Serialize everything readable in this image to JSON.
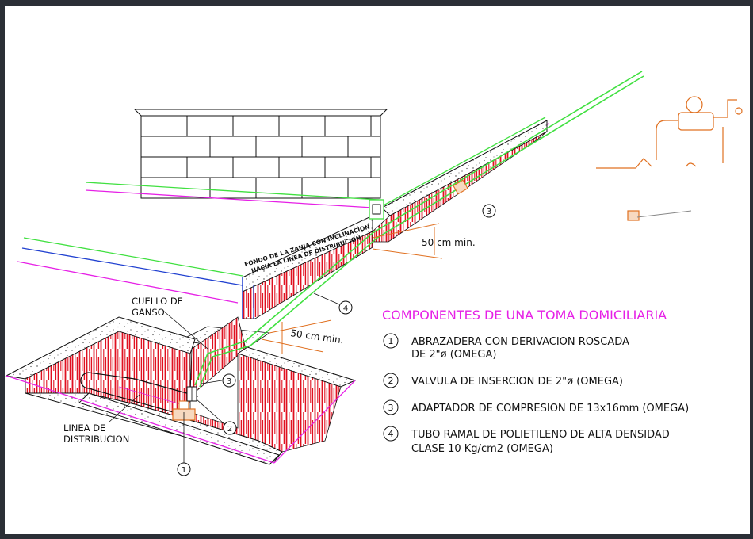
{
  "drawing": {
    "heading": "COMPONENTES DE UNA TOMA DOMICILIARIA",
    "legend": [
      {
        "num": "1",
        "lines": [
          "ABRAZADERA CON DERIVACION ROSCADA",
          "DE 2\"ø (OMEGA)"
        ]
      },
      {
        "num": "2",
        "lines": [
          "VALVULA DE INSERCION DE 2\"ø (OMEGA)"
        ]
      },
      {
        "num": "3",
        "lines": [
          "ADAPTADOR DE COMPRESION DE 13x16mm (OMEGA)"
        ]
      },
      {
        "num": "4",
        "lines": [
          "TUBO RAMAL DE POLIETILENO DE ALTA DENSIDAD",
          "CLASE 10 Kg/cm2 (OMEGA)"
        ]
      }
    ],
    "trench_note": [
      "FONDO DE LA ZANJA CON INCLINACION",
      "HACIA LA LINEA DE DISTRIBUCION"
    ],
    "gooseneck_label": [
      "CUELLO DE",
      "GANSO"
    ],
    "main_label": [
      "LINEA DE",
      "DISTRIBUCION"
    ],
    "dim_upper": "50 cm min.",
    "dim_lower": "50 cm min.",
    "callouts": {
      "c1": "1",
      "c2": "2",
      "c3a": "3",
      "c3b": "3",
      "c4": "4"
    },
    "colors": {
      "magenta": "#e620e6",
      "green": "#40e040",
      "red": "#e01020",
      "blue": "#2040d0",
      "orange": "#e07020",
      "black": "#111111"
    }
  }
}
